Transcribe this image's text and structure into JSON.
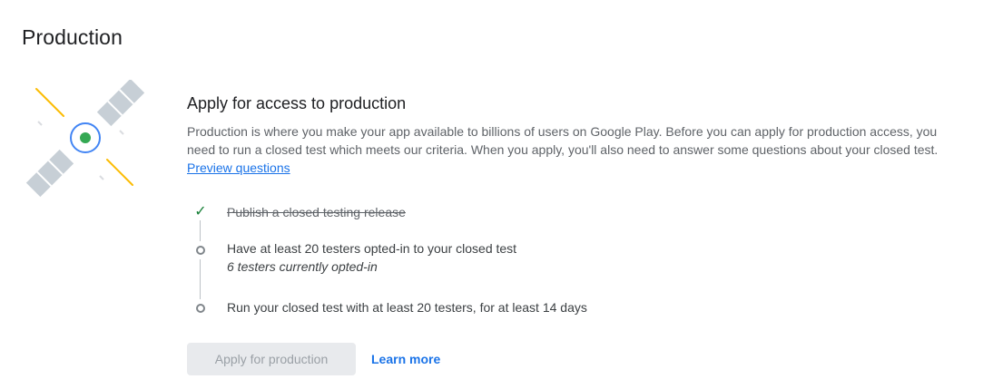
{
  "page": {
    "title": "Production"
  },
  "illustration": {
    "icon": "satellite-icon",
    "colors": {
      "panel": "#c7cfd6",
      "ring": "#4285f4",
      "center": "#34a853",
      "rays": "#fbbc04"
    }
  },
  "section": {
    "heading": "Apply for access to production",
    "description": "Production is where you make your app available to billions of users on Google Play. Before you can apply for production access, you need to run a closed test which meets our criteria. When you apply, you'll also need to answer some questions about your closed test.",
    "preview_link": "Preview questions"
  },
  "steps": [
    {
      "status": "complete",
      "icon": "checkmark-icon",
      "label": "Publish a closed testing release"
    },
    {
      "status": "pending",
      "icon": "circle-icon",
      "label": "Have at least 20 testers opted-in to your closed test",
      "sublabel": "6 testers currently opted-in"
    },
    {
      "status": "pending",
      "icon": "circle-icon",
      "label": "Run your closed test with at least 20 testers, for at least 14 days"
    }
  ],
  "actions": {
    "apply_label": "Apply for production",
    "apply_disabled": true,
    "learn_more_label": "Learn more"
  },
  "colors": {
    "accent": "#1a73e8",
    "success": "#188038",
    "disabled_bg": "#e8eaed",
    "disabled_text": "#9aa0a6"
  }
}
